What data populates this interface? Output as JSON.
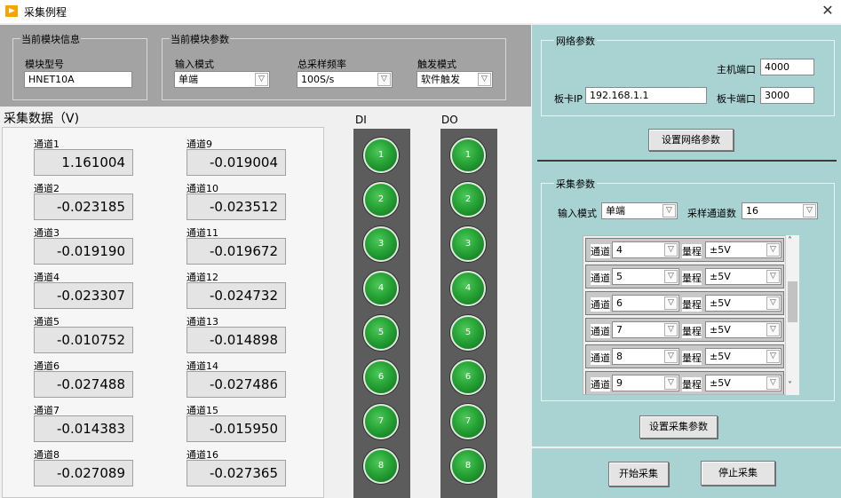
{
  "window": {
    "title": "采集例程",
    "close_label": "✕"
  },
  "module_info": {
    "group_title": "当前模块信息",
    "model_label": "模块型号",
    "model_value": "HNET10A"
  },
  "module_params": {
    "group_title": "当前模块参数",
    "input_mode_label": "输入模式",
    "input_mode_value": "单端",
    "sample_rate_label": "总采样频率",
    "sample_rate_value": "100S/s",
    "trigger_label": "触发模式",
    "trigger_value": "软件触发"
  },
  "data": {
    "title": "采集数据（V)",
    "channels": [
      {
        "label": "通道1",
        "value": "1.161004"
      },
      {
        "label": "通道2",
        "value": "-0.023185"
      },
      {
        "label": "通道3",
        "value": "-0.019190"
      },
      {
        "label": "通道4",
        "value": "-0.023307"
      },
      {
        "label": "通道5",
        "value": "-0.010752"
      },
      {
        "label": "通道6",
        "value": "-0.027488"
      },
      {
        "label": "通道7",
        "value": "-0.014383"
      },
      {
        "label": "通道8",
        "value": "-0.027089"
      },
      {
        "label": "通道9",
        "value": "-0.019004"
      },
      {
        "label": "通道10",
        "value": "-0.023512"
      },
      {
        "label": "通道11",
        "value": "-0.019672"
      },
      {
        "label": "通道12",
        "value": "-0.024732"
      },
      {
        "label": "通道13",
        "value": "-0.014898"
      },
      {
        "label": "通道14",
        "value": "-0.027486"
      },
      {
        "label": "通道15",
        "value": "-0.015950"
      },
      {
        "label": "通道16",
        "value": "-0.027365"
      }
    ]
  },
  "di": {
    "title": "DI",
    "leds": [
      "1",
      "2",
      "3",
      "4",
      "5",
      "6",
      "7",
      "8"
    ],
    "color": "#27a336"
  },
  "do": {
    "title": "DO",
    "leds": [
      "1",
      "2",
      "3",
      "4",
      "5",
      "6",
      "7",
      "8"
    ],
    "color": "#27a336"
  },
  "network": {
    "group_title": "网络参数",
    "host_port_label": "主机端口",
    "host_port_value": "4000",
    "board_ip_label": "板卡IP",
    "board_ip_value": "192.168.1.1",
    "board_port_label": "板卡端口",
    "board_port_value": "3000",
    "set_button": "设置网络参数"
  },
  "acquisition": {
    "group_title": "采集参数",
    "input_mode_label": "输入模式",
    "input_mode_value": "单端",
    "channel_count_label": "采样通道数",
    "channel_count_value": "16",
    "rows": [
      {
        "channel_label": "通道",
        "channel": "4",
        "range_label": "量程",
        "range": "±5V"
      },
      {
        "channel_label": "通道",
        "channel": "5",
        "range_label": "量程",
        "range": "±5V"
      },
      {
        "channel_label": "通道",
        "channel": "6",
        "range_label": "量程",
        "range": "±5V"
      },
      {
        "channel_label": "通道",
        "channel": "7",
        "range_label": "量程",
        "range": "±5V"
      },
      {
        "channel_label": "通道",
        "channel": "8",
        "range_label": "量程",
        "range": "±5V"
      },
      {
        "channel_label": "通道",
        "channel": "9",
        "range_label": "量程",
        "range": "±5V"
      }
    ],
    "set_button": "设置采集参数"
  },
  "controls": {
    "start_button": "开始采集",
    "stop_button": "停止采集"
  },
  "colors": {
    "top_panel": "#a3a3a3",
    "right_panel": "#a9d2d2",
    "io_column": "#5c5c5c",
    "led_on": "#27a336"
  }
}
